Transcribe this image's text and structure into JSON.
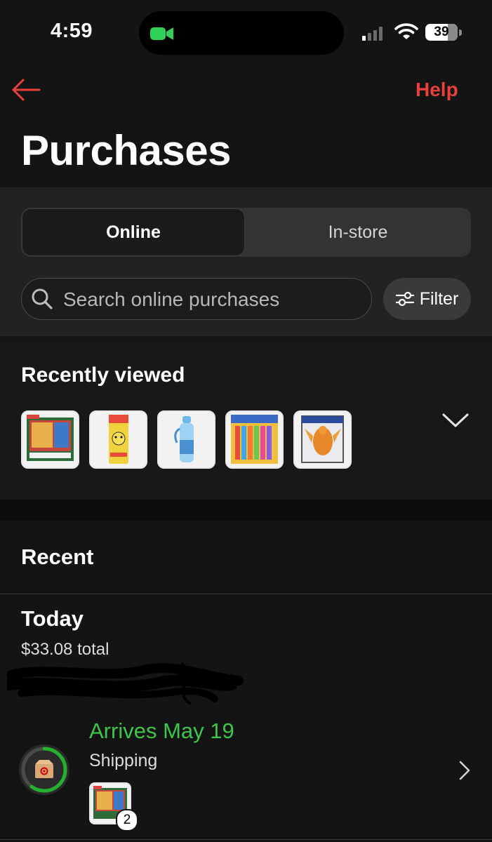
{
  "status_bar": {
    "time": "4:59",
    "battery": "39"
  },
  "header": {
    "back_icon": "arrow-left-icon",
    "help_label": "Help",
    "title": "Purchases"
  },
  "tabs": [
    {
      "label": "Online",
      "selected": true
    },
    {
      "label": "In-store",
      "selected": false
    }
  ],
  "search": {
    "placeholder": "Search online purchases",
    "value": ""
  },
  "filter": {
    "label": "Filter",
    "icon": "sliders-icon"
  },
  "recently_viewed": {
    "title": "Recently viewed",
    "items": [
      "pokemon-box-set",
      "pikachu-lip-balm",
      "water-bottle",
      "pokemon-lip-balm-pack",
      "charizard-figure"
    ],
    "expand_icon": "chevron-down-icon"
  },
  "recent": {
    "title": "Recent",
    "group": {
      "title": "Today",
      "total": "$33.08 total",
      "order": {
        "arrival": "Arrives May 19",
        "status": "Shipping",
        "item_count": "2",
        "progress": 0.6
      }
    }
  },
  "colors": {
    "accent": "#e8403a",
    "success": "#3ec64a",
    "background": "#141414"
  }
}
